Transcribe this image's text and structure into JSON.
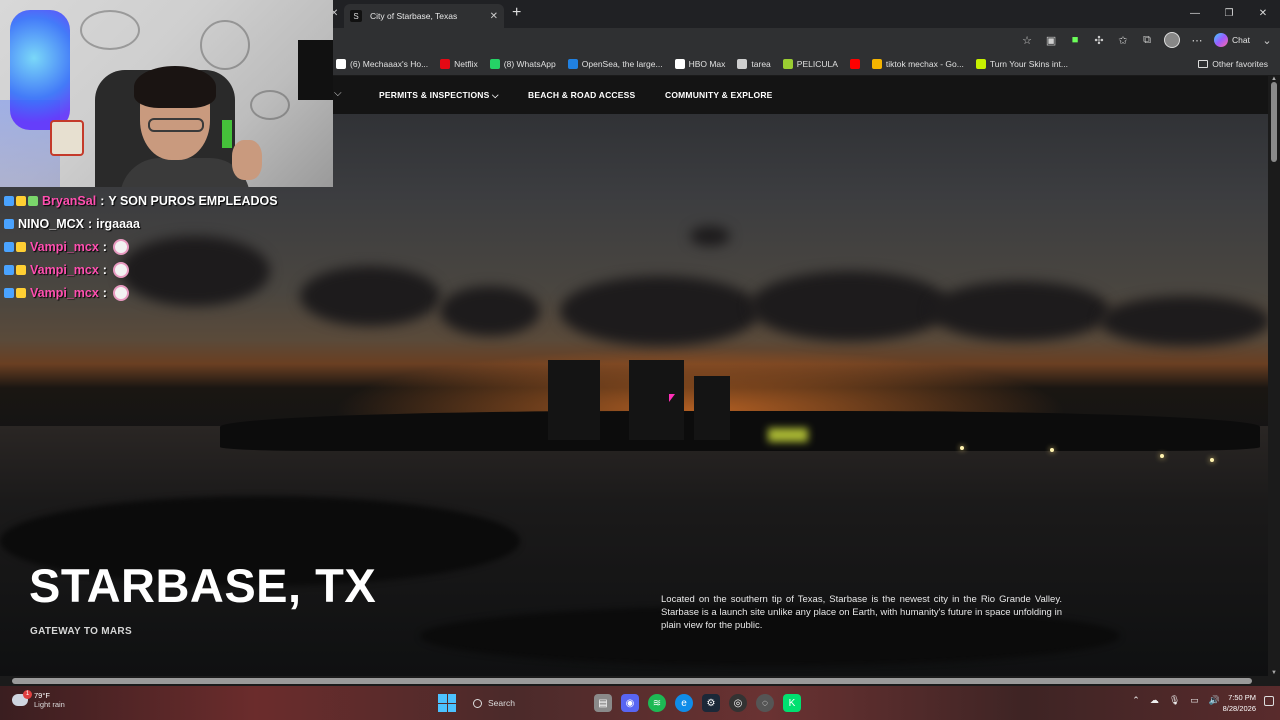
{
  "browser": {
    "tab_title": "City of Starbase, Texas",
    "tab_favicon": "S",
    "chat_label": "Chat",
    "bookmarks": [
      {
        "label": "(6) Mechaaax's Ho...",
        "icon": "x-icon",
        "color": "#ffffff"
      },
      {
        "label": "Netflix",
        "icon": "netflix-icon",
        "color": "#e50914"
      },
      {
        "label": "(8) WhatsApp",
        "icon": "whatsapp-icon",
        "color": "#25d366"
      },
      {
        "label": "OpenSea, the large...",
        "icon": "opensea-icon",
        "color": "#2081e2"
      },
      {
        "label": "HBO Max",
        "icon": "hbo-icon",
        "color": "#ffffff"
      },
      {
        "label": "tarea",
        "icon": "globe-icon",
        "color": "#cfcfcf"
      },
      {
        "label": "PELICULA",
        "icon": "film-icon",
        "color": "#9acd32"
      },
      {
        "label": "",
        "icon": "youtube-icon",
        "color": "#ff0000"
      },
      {
        "label": "tiktok mechax - Go...",
        "icon": "google-drive-icon",
        "color": "#f4b400"
      },
      {
        "label": "Turn Your Skins int...",
        "icon": "skin-icon",
        "color": "#c6f000"
      }
    ],
    "other_favorites": "Other favorites"
  },
  "site": {
    "nav": [
      {
        "label": "PERMITS & INSPECTIONS",
        "has_dropdown": true
      },
      {
        "label": "BEACH & ROAD ACCESS",
        "has_dropdown": false
      },
      {
        "label": "COMMUNITY & EXPLORE",
        "has_dropdown": false
      }
    ],
    "hero_title": "STARBASE, TX",
    "hero_subtitle": "GATEWAY TO MARS",
    "hero_description": "Located on the southern tip of Texas, Starbase is the newest city in the Rio Grande Valley. Starbase is a launch site unlike any place on Earth, with humanity's future in space unfolding in plain view for the public."
  },
  "stream_chat": [
    {
      "user": "BryanSal",
      "user_color": "#ff4fb0",
      "message": "Y SON PUROS EMPLEADOS",
      "emote": false
    },
    {
      "user": "NINO_MCX",
      "user_color": "#ffffff",
      "message": "irgaaaa",
      "emote": false
    },
    {
      "user": "Vampi_mcx",
      "user_color": "#ff4fb0",
      "message": "",
      "emote": true
    },
    {
      "user": "Vampi_mcx",
      "user_color": "#ff4fb0",
      "message": "",
      "emote": true
    },
    {
      "user": "Vampi_mcx",
      "user_color": "#ff4fb0",
      "message": "",
      "emote": true
    }
  ],
  "taskbar": {
    "weather_temp": "79°F",
    "weather_desc": "Light rain",
    "weather_badge": "1",
    "search_placeholder": "Search",
    "time": "7:50 PM",
    "date": "8/28/2026"
  }
}
